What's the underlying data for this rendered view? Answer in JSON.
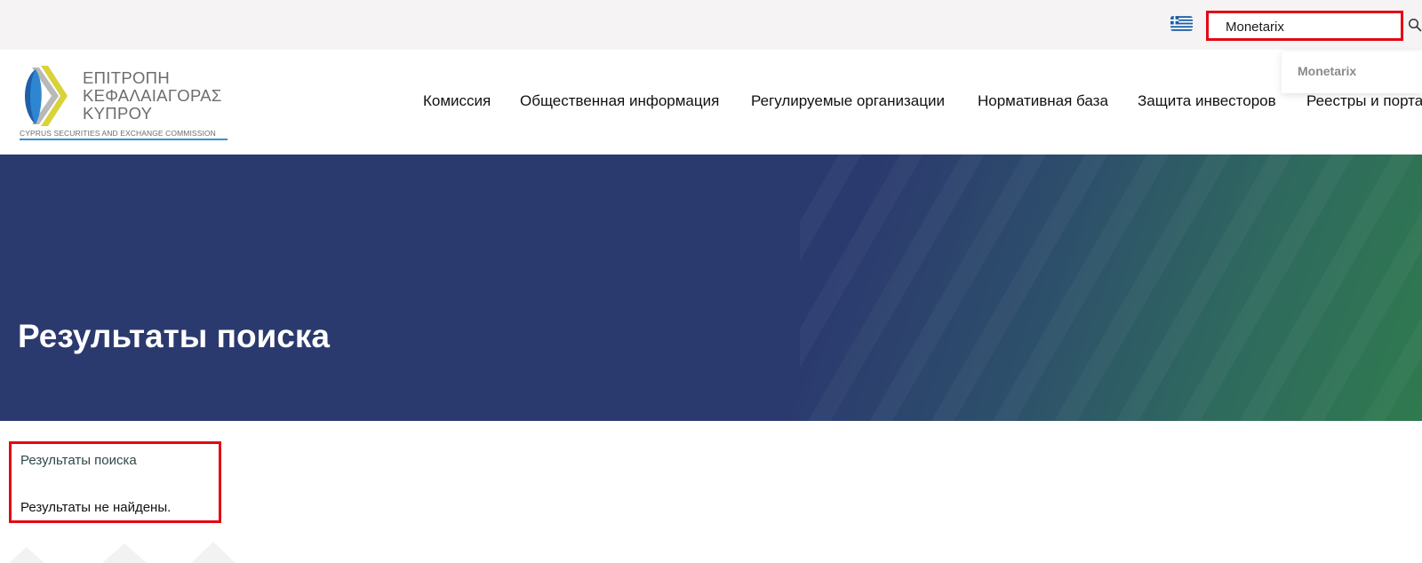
{
  "topbar": {
    "language_flag": "greek-flag-icon",
    "search": {
      "value": "Monetarix",
      "placeholder": ""
    },
    "search_icon": "search-icon",
    "suggestions": [
      "Monetarix"
    ]
  },
  "logo": {
    "line1": "ΕΠΙΤΡΟΠΗ",
    "line2": "ΚΕΦΑΛΑΙΑΓΟΡΑΣ",
    "line3": "ΚΥΠΡΟΥ",
    "subtitle": "CYPRUS SECURITIES AND EXCHANGE COMMISSION"
  },
  "nav": {
    "items": [
      {
        "label": "Комиссия"
      },
      {
        "label": "Общественная информация"
      },
      {
        "label": "Регулируемые организации"
      },
      {
        "label": "Нормативная база"
      },
      {
        "label": "Защита инвесторов"
      },
      {
        "label": "Реестры и порта"
      }
    ]
  },
  "hero": {
    "title": "Результаты поиска"
  },
  "results": {
    "title": "Результаты поиска",
    "empty_message": "Результаты не найдены."
  },
  "colors": {
    "hero_blue": "#2b3a6e",
    "hero_green": "#2f7a4e",
    "highlight_red": "#e30613",
    "topbar_bg": "#f5f3f3"
  }
}
